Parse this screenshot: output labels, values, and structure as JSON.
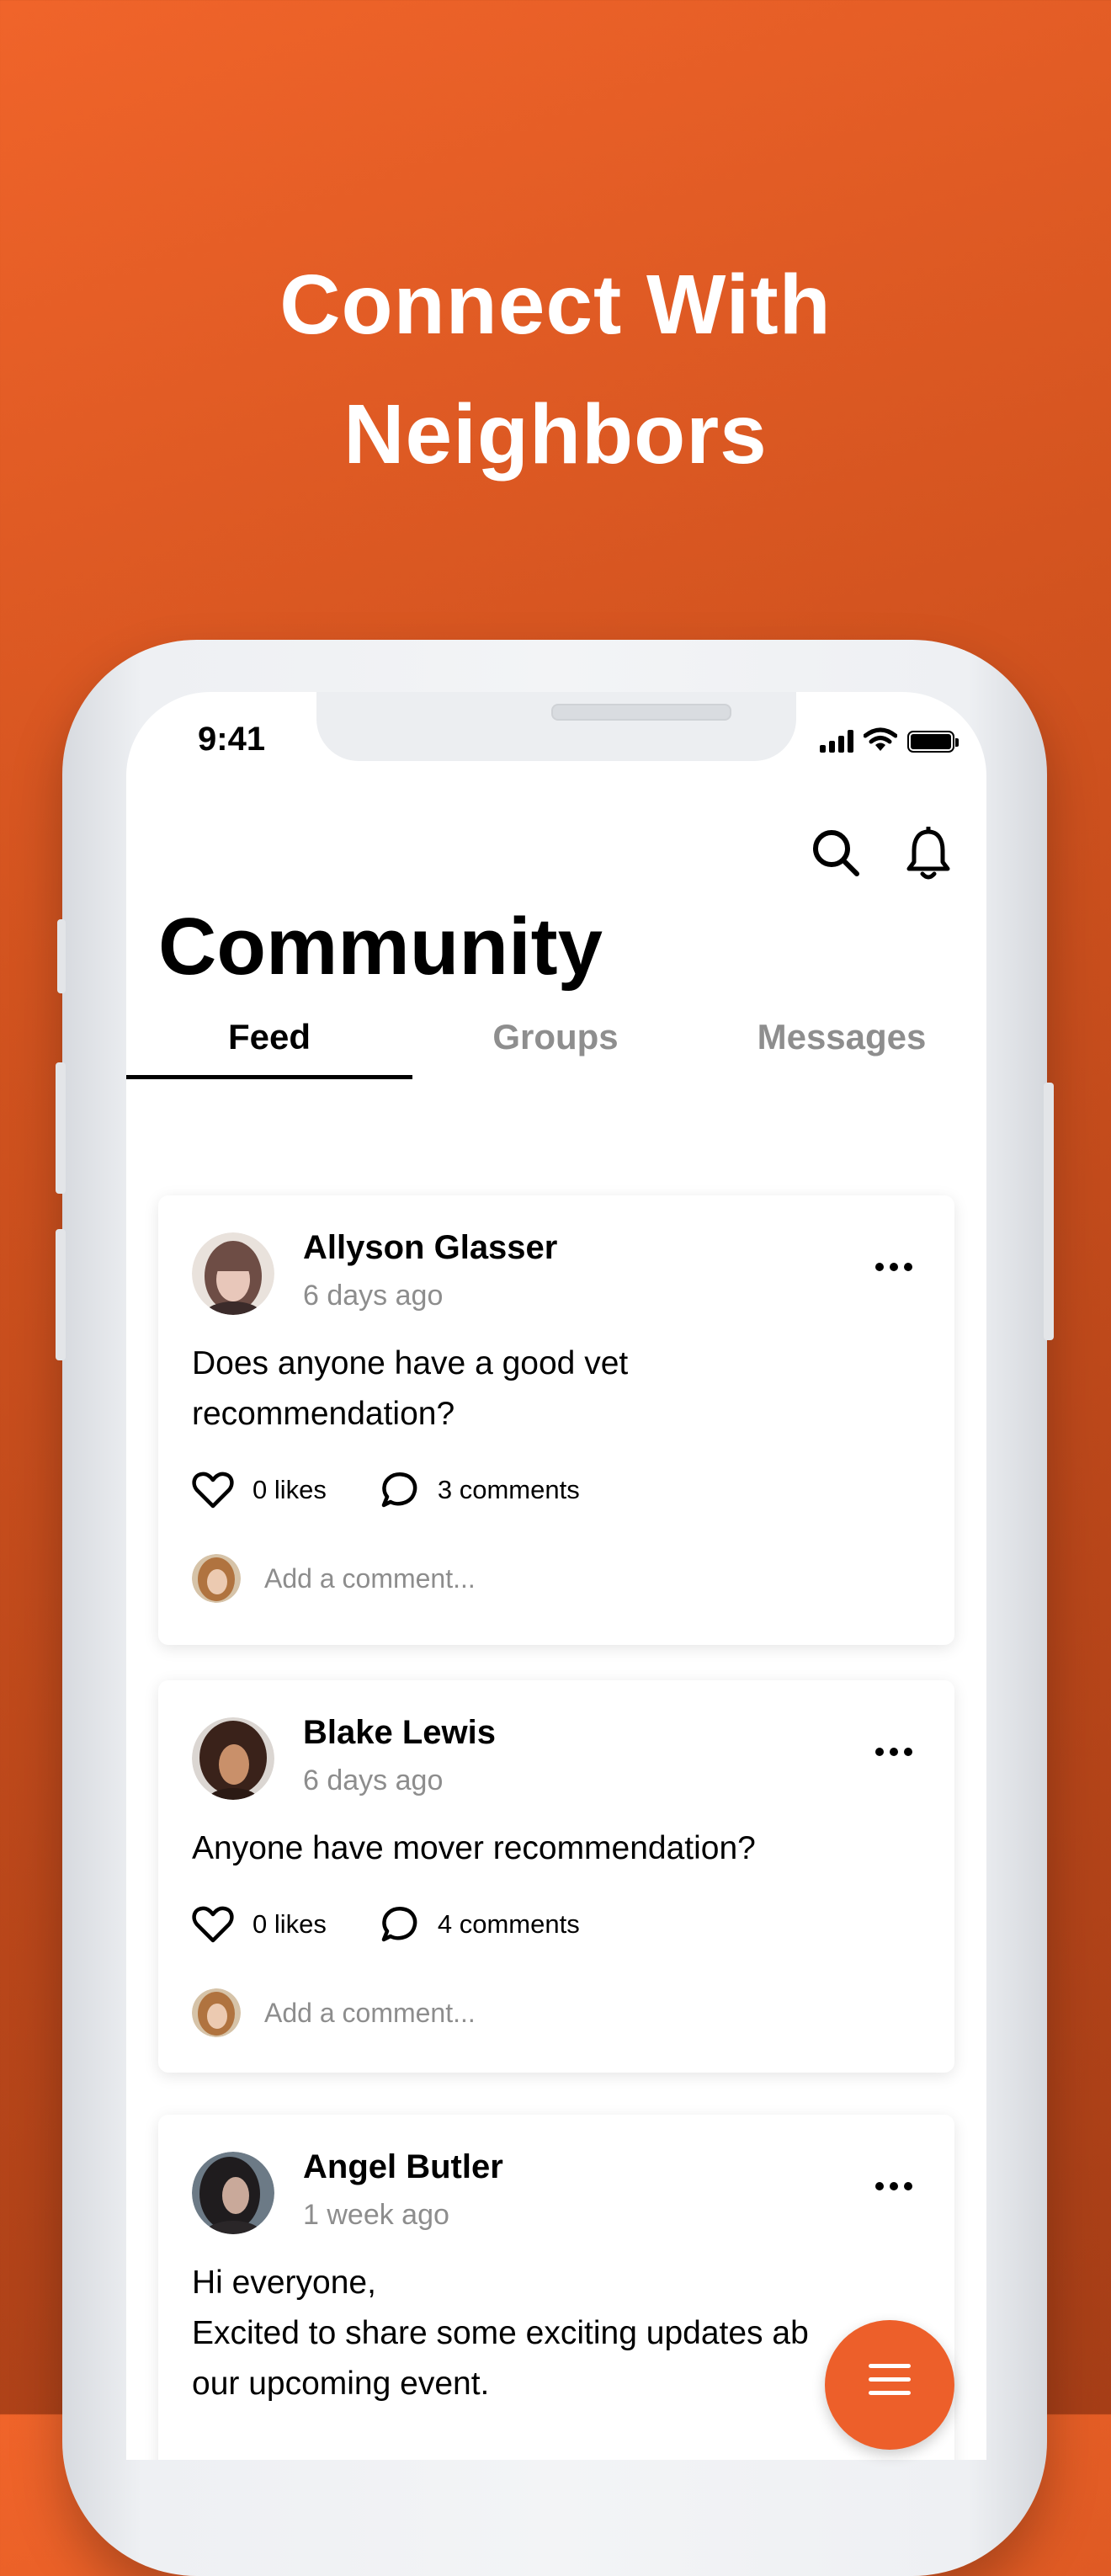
{
  "headline": {
    "line1": "Connect With",
    "line2": "Neighbors"
  },
  "status_bar": {
    "time": "9:41"
  },
  "header": {
    "title": "Community",
    "search_icon": "search-icon",
    "bell_icon": "bell-icon"
  },
  "tabs": [
    {
      "label": "Feed",
      "active": true
    },
    {
      "label": "Groups",
      "active": false
    },
    {
      "label": "Messages",
      "active": false
    }
  ],
  "posts": [
    {
      "author": "Allyson Glasser",
      "ago": "6 days ago",
      "text_lines": [
        "Does anyone have a good vet",
        "recommendation?"
      ],
      "likes": "0 likes",
      "comments": "3 comments",
      "comment_placeholder": "Add a comment..."
    },
    {
      "author": "Blake Lewis",
      "ago": "6 days ago",
      "text_lines": [
        "Anyone have mover recommendation?"
      ],
      "likes": "0 likes",
      "comments": "4 comments",
      "comment_placeholder": "Add a comment..."
    },
    {
      "author": "Angel Butler",
      "ago": "1 week ago",
      "text_lines": [
        "Hi everyone,",
        "Excited to share some exciting updates ab",
        "our upcoming event."
      ]
    }
  ],
  "colors": {
    "accent": "#ed5f2a",
    "background_top": "#f0642a",
    "background_bottom": "#a63e17"
  },
  "fab_icon": "menu-icon"
}
